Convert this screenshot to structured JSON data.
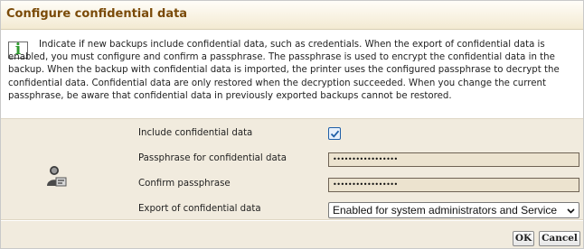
{
  "dialog": {
    "title": "Configure confidential data"
  },
  "info": {
    "icon": "info-icon",
    "text": "Indicate if new backups include confidential data, such as credentials. When the export of confidential data is enabled, you must configure and confirm a passphrase. The passphrase is used to encrypt the confidential data in the backup. When the backup with confidential data is imported, the printer uses the configured passphrase to decrypt the confidential data. Confidential data are only restored when the decryption succeeded. When you change the current passphrase, be aware that confidential data in previously exported backups cannot be restored."
  },
  "form": {
    "icon": "user-profile-icon",
    "include": {
      "label": "Include confidential data",
      "checked": true
    },
    "passphrase": {
      "label": "Passphrase for confidential data",
      "value": "•••••••••••••••••"
    },
    "confirm": {
      "label": "Confirm passphrase",
      "value": "•••••••••••••••••"
    },
    "export": {
      "label": "Export of confidential data",
      "selected": "Enabled for system administrators and Service"
    }
  },
  "footer": {
    "ok_label": "OK",
    "cancel_label": "Cancel"
  },
  "colors": {
    "title": "#7a4a08",
    "form_bg": "#f1ebde",
    "info_icon": "#2e9a2e",
    "checkbox": "#1f5fa8"
  }
}
